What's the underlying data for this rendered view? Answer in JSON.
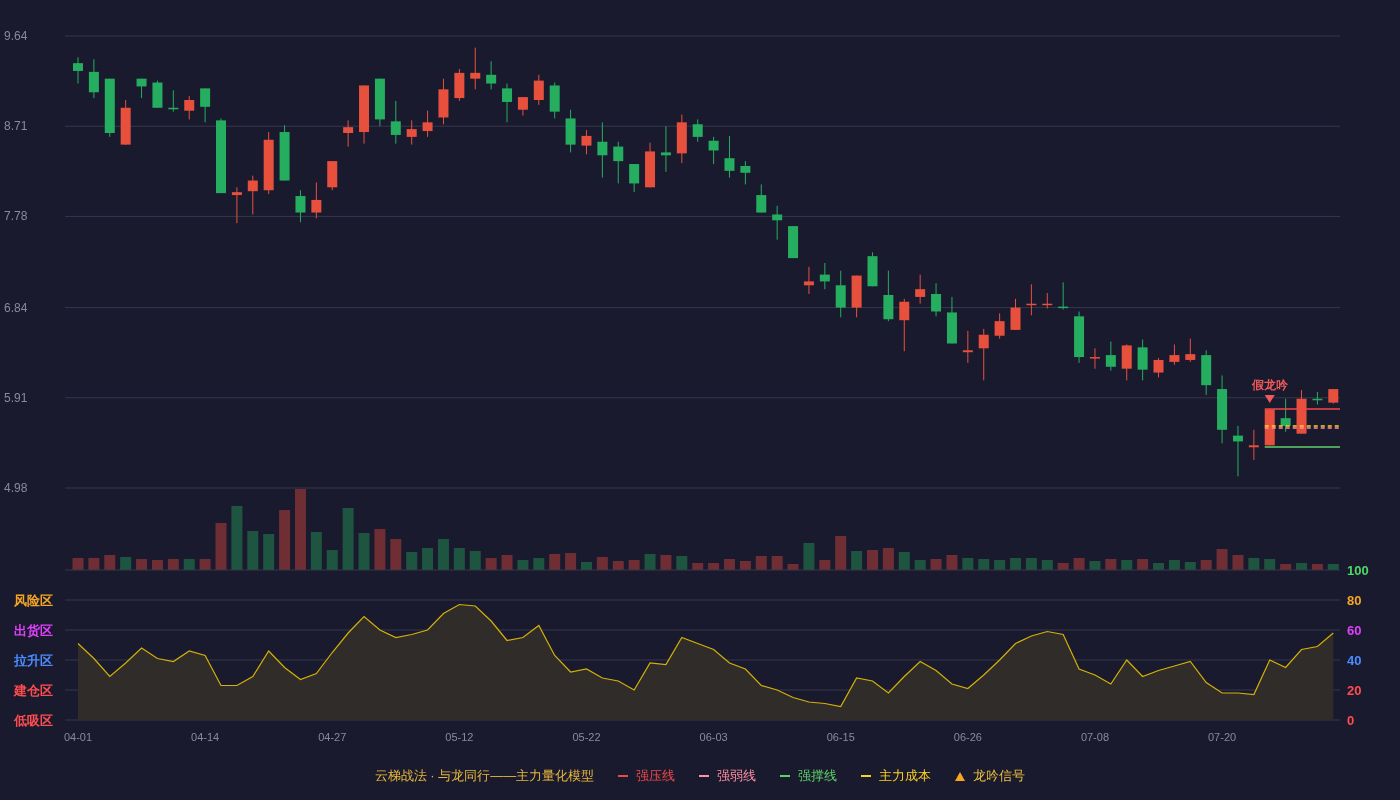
{
  "price_chart": {
    "chart_data": {
      "type": "candlestick",
      "grid": true,
      "ylim": [
        4.98,
        9.64
      ],
      "yticks": [
        9.64,
        8.71,
        7.78,
        6.84,
        5.91,
        4.98
      ],
      "ohlc": [
        [
          9.36,
          9.42,
          9.15,
          9.28
        ],
        [
          9.27,
          9.4,
          9.0,
          9.06
        ],
        [
          9.2,
          9.2,
          8.6,
          8.64
        ],
        [
          8.52,
          8.98,
          8.52,
          8.9
        ],
        [
          9.2,
          9.2,
          9.0,
          9.12
        ],
        [
          9.16,
          9.18,
          8.9,
          8.9
        ],
        [
          8.9,
          9.08,
          8.86,
          8.89
        ],
        [
          8.87,
          9.02,
          8.78,
          8.98
        ],
        [
          9.1,
          9.1,
          8.75,
          8.91
        ],
        [
          8.77,
          8.79,
          8.02,
          8.02
        ],
        [
          8.0,
          8.08,
          7.71,
          8.03
        ],
        [
          8.04,
          8.2,
          7.8,
          8.15
        ],
        [
          8.05,
          8.65,
          8.01,
          8.57
        ],
        [
          8.65,
          8.72,
          8.15,
          8.15
        ],
        [
          7.99,
          8.05,
          7.72,
          7.82
        ],
        [
          7.82,
          8.13,
          7.76,
          7.95
        ],
        [
          8.08,
          8.35,
          8.05,
          8.35
        ],
        [
          8.64,
          8.77,
          8.5,
          8.7
        ],
        [
          8.65,
          9.13,
          8.53,
          9.13
        ],
        [
          9.2,
          9.2,
          8.71,
          8.78
        ],
        [
          8.76,
          8.97,
          8.53,
          8.62
        ],
        [
          8.6,
          8.77,
          8.52,
          8.68
        ],
        [
          8.66,
          8.87,
          8.6,
          8.75
        ],
        [
          8.8,
          9.2,
          8.73,
          9.09
        ],
        [
          9.0,
          9.3,
          8.97,
          9.26
        ],
        [
          9.2,
          9.52,
          9.09,
          9.26
        ],
        [
          9.24,
          9.38,
          9.09,
          9.15
        ],
        [
          9.1,
          9.15,
          8.75,
          8.96
        ],
        [
          8.88,
          9.01,
          8.82,
          9.01
        ],
        [
          8.98,
          9.24,
          8.93,
          9.18
        ],
        [
          9.13,
          9.16,
          8.79,
          8.86
        ],
        [
          8.79,
          8.88,
          8.44,
          8.52
        ],
        [
          8.51,
          8.67,
          8.42,
          8.61
        ],
        [
          8.55,
          8.75,
          8.18,
          8.41
        ],
        [
          8.5,
          8.55,
          8.12,
          8.35
        ],
        [
          8.32,
          8.32,
          8.03,
          8.12
        ],
        [
          8.08,
          8.54,
          8.08,
          8.45
        ],
        [
          8.44,
          8.71,
          8.24,
          8.41
        ],
        [
          8.43,
          8.83,
          8.33,
          8.75
        ],
        [
          8.73,
          8.78,
          8.55,
          8.6
        ],
        [
          8.56,
          8.6,
          8.32,
          8.46
        ],
        [
          8.38,
          8.61,
          8.18,
          8.25
        ],
        [
          8.3,
          8.35,
          8.11,
          8.23
        ],
        [
          8.0,
          8.11,
          7.82,
          7.82
        ],
        [
          7.8,
          7.89,
          7.54,
          7.74
        ],
        [
          7.68,
          7.68,
          7.35,
          7.35
        ],
        [
          7.07,
          7.26,
          6.98,
          7.11
        ],
        [
          7.18,
          7.3,
          7.03,
          7.11
        ],
        [
          7.07,
          7.22,
          6.74,
          6.84
        ],
        [
          6.84,
          7.17,
          6.74,
          7.17
        ],
        [
          7.37,
          7.41,
          7.06,
          7.06
        ],
        [
          6.97,
          7.22,
          6.7,
          6.72
        ],
        [
          6.71,
          6.93,
          6.39,
          6.9
        ],
        [
          6.95,
          7.18,
          6.88,
          7.03
        ],
        [
          6.98,
          7.09,
          6.75,
          6.8
        ],
        [
          6.79,
          6.95,
          6.47,
          6.47
        ],
        [
          6.38,
          6.6,
          6.27,
          6.4
        ],
        [
          6.42,
          6.62,
          6.09,
          6.56
        ],
        [
          6.55,
          6.78,
          6.52,
          6.7
        ],
        [
          6.61,
          6.93,
          6.61,
          6.84
        ],
        [
          6.87,
          7.08,
          6.76,
          6.88
        ],
        [
          6.87,
          6.99,
          6.83,
          6.88
        ],
        [
          6.85,
          7.1,
          6.82,
          6.84
        ],
        [
          6.75,
          6.8,
          6.27,
          6.33
        ],
        [
          6.32,
          6.42,
          6.21,
          6.33
        ],
        [
          6.35,
          6.49,
          6.19,
          6.23
        ],
        [
          6.21,
          6.46,
          6.09,
          6.45
        ],
        [
          6.43,
          6.51,
          6.09,
          6.2
        ],
        [
          6.17,
          6.32,
          6.12,
          6.3
        ],
        [
          6.28,
          6.46,
          6.25,
          6.35
        ],
        [
          6.3,
          6.52,
          6.28,
          6.36
        ],
        [
          6.35,
          6.4,
          5.94,
          6.04
        ],
        [
          6.0,
          6.14,
          5.44,
          5.58
        ],
        [
          5.52,
          5.62,
          5.1,
          5.46
        ],
        [
          5.4,
          5.58,
          5.27,
          5.42
        ],
        [
          5.42,
          5.79,
          5.42,
          5.79
        ],
        [
          5.7,
          5.9,
          5.56,
          5.62
        ],
        [
          5.54,
          5.99,
          5.54,
          5.9
        ],
        [
          5.9,
          5.97,
          5.84,
          5.89
        ],
        [
          5.86,
          6.0,
          5.85,
          6.0
        ]
      ],
      "annotations": [
        "假龙吟"
      ]
    },
    "signal": {
      "color": "#f05a5a"
    }
  },
  "oscillator": {
    "chart_data": {
      "type": "area",
      "grid": true,
      "ylim": [
        0,
        100
      ],
      "yticks": [
        100,
        80,
        60,
        40,
        20,
        0
      ],
      "series": [
        {
          "color": "#d4b106",
          "values": [
            51,
            41,
            29,
            38,
            48,
            41,
            39,
            46,
            43,
            23,
            23,
            29,
            46,
            35,
            27,
            31,
            45,
            58,
            69,
            60,
            55,
            57,
            60,
            71,
            77,
            76,
            66,
            53,
            55,
            63,
            43,
            32,
            34,
            28,
            26,
            20,
            38,
            37,
            55,
            51,
            47,
            38,
            34,
            23,
            20,
            15,
            12,
            11,
            9,
            28,
            26,
            18,
            29,
            39,
            33,
            24,
            21,
            30,
            40,
            51,
            56,
            59,
            57,
            34,
            30,
            24,
            40,
            29,
            33,
            36,
            39,
            25,
            18,
            18,
            17,
            40,
            35,
            47,
            49,
            58
          ]
        }
      ]
    },
    "x_axis_labels": [
      "04-01",
      "04-14",
      "04-27",
      "05-12",
      "05-22",
      "06-03",
      "06-15",
      "06-26",
      "07-08",
      "07-20"
    ],
    "right_ticks": [
      {
        "label": "100",
        "color": "#4cd964"
      },
      {
        "label": "80",
        "color": "#f5a623"
      },
      {
        "label": "60",
        "color": "#e040fb"
      },
      {
        "label": "40",
        "color": "#4a8cff"
      },
      {
        "label": "20",
        "color": "#ff4d4f"
      },
      {
        "label": "0",
        "color": "#ff4d4f"
      }
    ],
    "zones": [
      {
        "label": "风险区",
        "color": "#f5a623"
      },
      {
        "label": "出货区",
        "color": "#e040fb"
      },
      {
        "label": "拉升区",
        "color": "#4a8cff"
      },
      {
        "label": "建仓区",
        "color": "#ff4d4f"
      },
      {
        "label": "低吸区",
        "color": "#ff4d4f"
      }
    ]
  },
  "legend": {
    "title": "云梯战法 · 与龙同行——主力量化模型",
    "items": [
      {
        "kind": "solid",
        "label": "强压线",
        "color": "#f04848"
      },
      {
        "kind": "dashed",
        "label": "强弱线",
        "color": "#ff8fa3"
      },
      {
        "kind": "solid",
        "label": "强撑线",
        "color": "#5fd068"
      },
      {
        "kind": "dashed",
        "label": "主力成本",
        "color": "#ffd21f"
      },
      {
        "kind": "triangle",
        "label": "龙吟信号",
        "color": "#f5a623"
      }
    ]
  }
}
